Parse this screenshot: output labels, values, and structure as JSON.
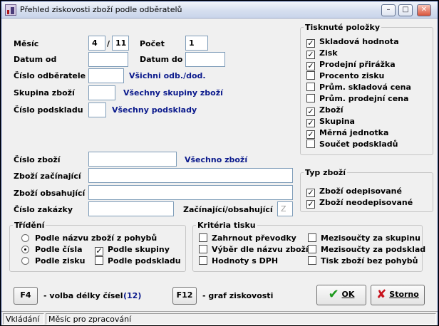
{
  "window": {
    "title": "Přehled ziskovosti zboží podle odběratelů",
    "min": "–",
    "max": "□",
    "close": "✕"
  },
  "form": {
    "mesic_label": "Měsíc",
    "mesic_value": "4",
    "slash": "/",
    "rok_value": "11",
    "pocet_label": "Počet",
    "pocet_value": "1",
    "datum_od_label": "Datum od",
    "datum_od_value": "",
    "datum_do_label": "Datum do",
    "datum_do_value": "",
    "cislo_odberatele_label": "Číslo odběratele",
    "cislo_odberatele_value": "",
    "cislo_odberatele_info": "Všichni odb./dod.",
    "skupina_zbozi_label": "Skupina zboží",
    "skupina_zbozi_value": "",
    "skupina_zbozi_info": "Všechny skupiny zboží",
    "cislo_podskladu_label": "Číslo podskladu",
    "cislo_podskladu_value": "",
    "cislo_podskladu_info": "Všechny podsklady",
    "cislo_zbozi_label": "Číslo zboží",
    "cislo_zbozi_value": "",
    "cislo_zbozi_info": "Všechno zboží",
    "zbozi_zacinajici_label": "Zboží začínající",
    "zbozi_zacinajici_value": "",
    "zbozi_obsahujici_label": "Zboží obsahující",
    "zbozi_obsahujici_value": "",
    "cislo_zakazky_label": "Číslo zakázky",
    "cislo_zakazky_value": "",
    "zac_obs_label": "Začínající/obsahující",
    "zac_obs_value": "Z"
  },
  "tisknute": {
    "legend": "Tisknuté položky",
    "items": [
      {
        "label": "Skladová hodnota",
        "mark": "✓"
      },
      {
        "label": "Zisk",
        "mark": "✓"
      },
      {
        "label": "Prodejní přirážka",
        "mark": "✓"
      },
      {
        "label": "Procento zisku",
        "mark": ""
      },
      {
        "label": "Prům. skladová cena",
        "mark": ""
      },
      {
        "label": "Prům. prodejní cena",
        "mark": ""
      },
      {
        "label": "Zboží",
        "mark": "✓"
      },
      {
        "label": "Skupina",
        "mark": "✓"
      },
      {
        "label": "Měrná jednotka",
        "mark": "✓"
      },
      {
        "label": "Součet podskladů",
        "mark": ""
      }
    ]
  },
  "typ_zbozi": {
    "legend": "Typ zboží",
    "items": [
      {
        "label": "Zboží odepisované",
        "mark": "✓"
      },
      {
        "label": "Zboží neodepisované",
        "mark": "✓"
      }
    ]
  },
  "trideni": {
    "legend": "Třídění",
    "radios": [
      {
        "label": "Podle názvu zboží z pohybů",
        "selected": false
      },
      {
        "label": "Podle čísla",
        "selected": true
      },
      {
        "label": "Podle zisku",
        "selected": false
      }
    ],
    "checks": [
      {
        "label": "Podle skupiny",
        "mark": "✓"
      },
      {
        "label": "Podle podskladu",
        "mark": ""
      }
    ]
  },
  "kriteria": {
    "legend": "Kritéria tisku",
    "items": [
      {
        "label": "Zahrnout převodky",
        "mark": ""
      },
      {
        "label": "Výběr dle názvu zboží",
        "mark": ""
      },
      {
        "label": "Hodnoty s DPH",
        "mark": ""
      },
      {
        "label": "Mezisoučty za skupinu",
        "mark": ""
      },
      {
        "label": "Mezisoučty za podsklad",
        "mark": ""
      },
      {
        "label": "Tisk zboží bez pohybů",
        "mark": ""
      }
    ]
  },
  "bottom": {
    "f4_label": "F4",
    "f4_text": "- volba délky čísel",
    "f4_value": "(12)",
    "f12_label": "F12",
    "f12_text": "- graf ziskovosti",
    "ok_label": "OK",
    "ok_icon": "✔",
    "storno_label": "Storno",
    "storno_icon": "✘"
  },
  "status": {
    "mode": "Vkládání",
    "hint": "Měsíc pro zpracování"
  },
  "colors": {
    "info_text": "#0b1a8c",
    "ok_icon": "#1e9a1e",
    "storno_icon": "#c8141e"
  }
}
